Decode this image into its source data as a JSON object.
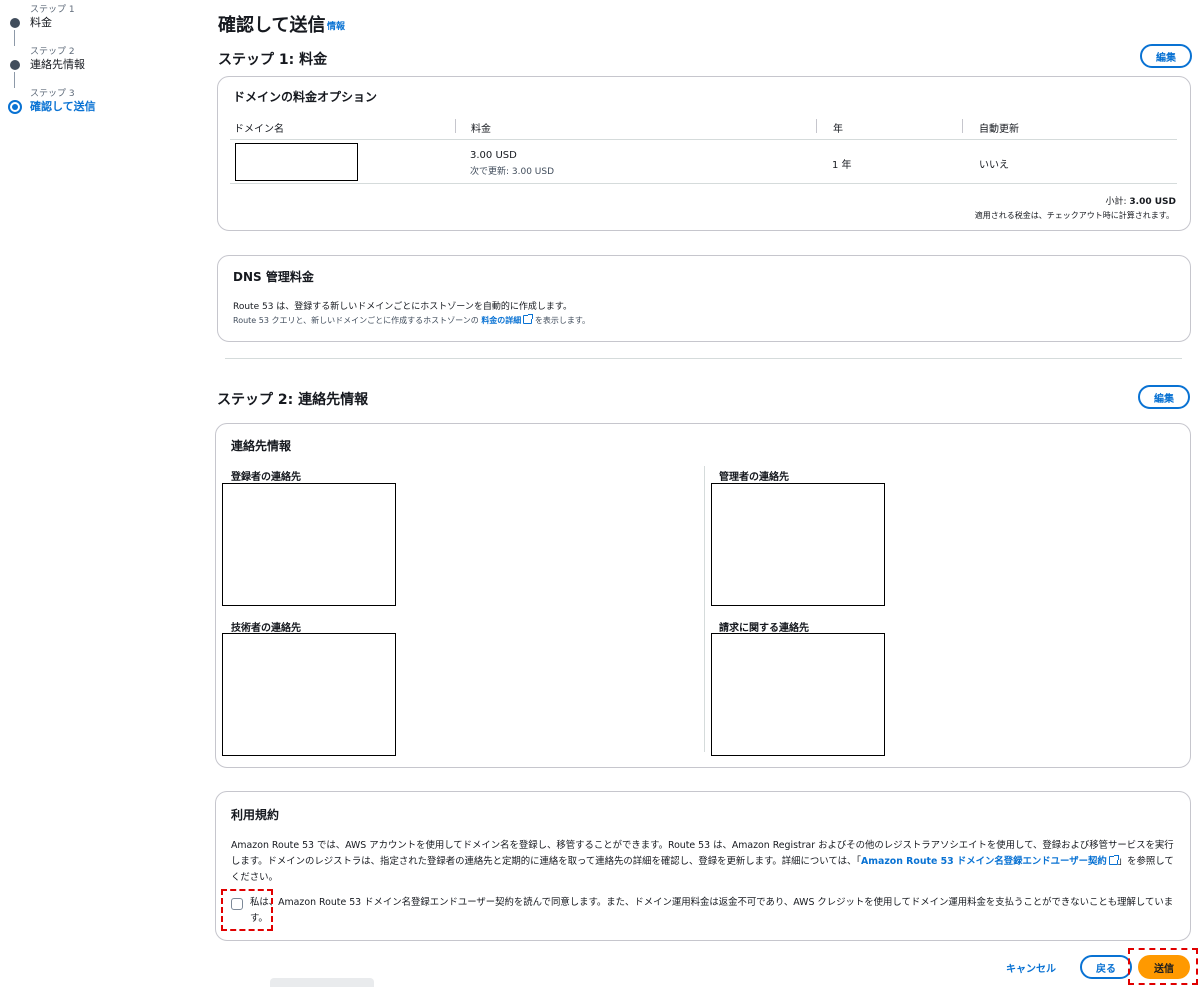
{
  "steps": [
    {
      "sub": "ステップ 1",
      "label": "料金"
    },
    {
      "sub": "ステップ 2",
      "label": "連絡先情報"
    },
    {
      "sub": "ステップ 3",
      "label": "確認して送信"
    }
  ],
  "page": {
    "title": "確認して送信",
    "info": "情報"
  },
  "step1": {
    "title": "ステップ 1: 料金",
    "edit": "編集",
    "pricing_card": {
      "title": "ドメインの料金オプション",
      "columns": [
        "ドメイン名",
        "料金",
        "年",
        "自動更新"
      ],
      "row": {
        "price": "3.00 USD",
        "renew": "次で更新: 3.00 USD",
        "years": "1 年",
        "auto_renew": "いいえ"
      },
      "subtotal_label": "小計:",
      "subtotal_value": "3.00 USD",
      "tax_note": "適用される税金は、チェックアウト時に計算されます。"
    },
    "dns_card": {
      "title": "DNS 管理料金",
      "desc": "Route 53 は、登録する新しいドメインごとにホストゾーンを自動的に作成します。",
      "note_pre": "Route 53 クエリと、新しいドメインごとに作成するホストゾーンの",
      "note_link": "料金の詳細",
      "note_post": "を表示します。"
    }
  },
  "step2": {
    "title": "ステップ 2: 連絡先情報",
    "edit": "編集",
    "card_title": "連絡先情報",
    "registrant": "登録者の連絡先",
    "admin": "管理者の連絡先",
    "tech": "技術者の連絡先",
    "billing": "請求に関する連絡先"
  },
  "tos": {
    "title": "利用規約",
    "body_pre": "Amazon Route 53 では、AWS アカウントを使用してドメイン名を登録し、移管することができます。Route 53 は、Amazon Registrar およびその他のレジストラアソシエイトを使用して、登録および移管サービスを実行します。ドメインのレジストラは、指定された登録者の連絡先と定期的に連絡を取って連絡先の詳細を確認し、登録を更新します。詳細については、「",
    "body_link": "Amazon Route 53 ドメイン名登録エンドユーザー契約",
    "body_post": "」を参照してください。",
    "agree": "私は、Amazon Route 53 ドメイン名登録エンドユーザー契約を読んで同意します。また、ドメイン運用料金は返金不可であり、AWS クレジットを使用してドメイン運用料金を支払うことができないことも理解しています。"
  },
  "footer": {
    "cancel": "キャンセル",
    "back": "戻る",
    "submit": "送信"
  }
}
